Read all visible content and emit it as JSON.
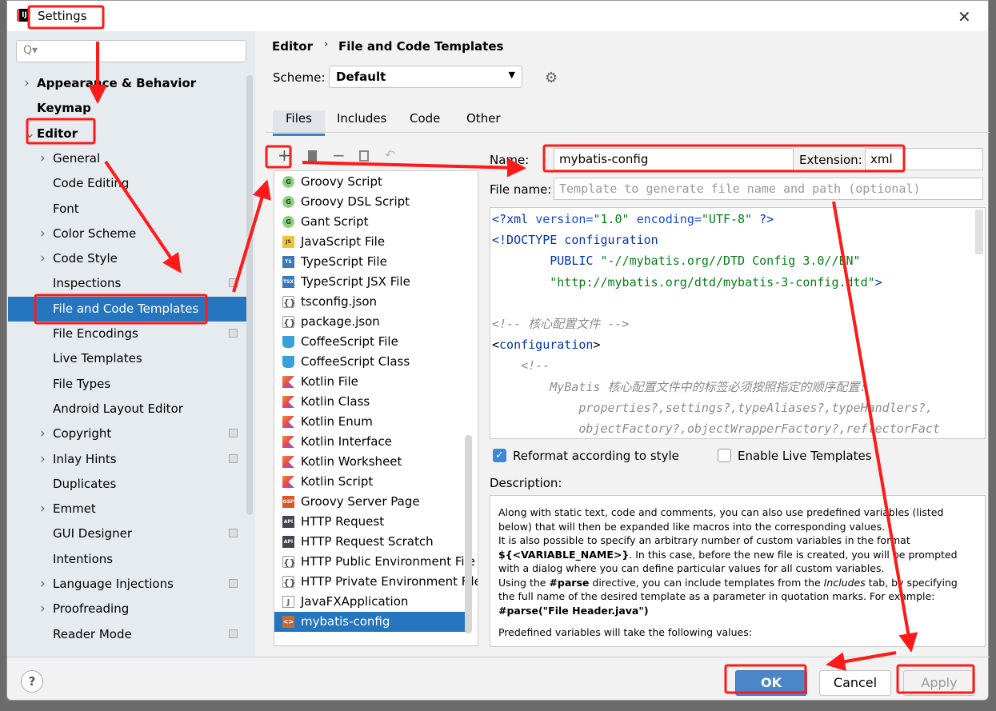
{
  "window": {
    "title": "Settings",
    "app_icon": "IJ"
  },
  "sidebar": {
    "search_placeholder": "Q▾",
    "items": [
      {
        "label": "Appearance & Behavior",
        "level": 0,
        "arrow": "collapsed"
      },
      {
        "label": "Keymap",
        "level": 0,
        "arrow": ""
      },
      {
        "label": "Editor",
        "level": 0,
        "arrow": "expanded"
      },
      {
        "label": "General",
        "level": 1,
        "arrow": "collapsed"
      },
      {
        "label": "Code Editing",
        "level": 1,
        "arrow": ""
      },
      {
        "label": "Font",
        "level": 1,
        "arrow": ""
      },
      {
        "label": "Color Scheme",
        "level": 1,
        "arrow": "collapsed"
      },
      {
        "label": "Code Style",
        "level": 1,
        "arrow": "collapsed"
      },
      {
        "label": "Inspections",
        "level": 1,
        "arrow": "",
        "copy": true
      },
      {
        "label": "File and Code Templates",
        "level": 1,
        "arrow": "",
        "copy": true,
        "selected": true
      },
      {
        "label": "File Encodings",
        "level": 1,
        "arrow": "",
        "copy": true
      },
      {
        "label": "Live Templates",
        "level": 1,
        "arrow": ""
      },
      {
        "label": "File Types",
        "level": 1,
        "arrow": ""
      },
      {
        "label": "Android Layout Editor",
        "level": 1,
        "arrow": ""
      },
      {
        "label": "Copyright",
        "level": 1,
        "arrow": "collapsed",
        "copy": true
      },
      {
        "label": "Inlay Hints",
        "level": 1,
        "arrow": "collapsed",
        "copy": true
      },
      {
        "label": "Duplicates",
        "level": 1,
        "arrow": ""
      },
      {
        "label": "Emmet",
        "level": 1,
        "arrow": "collapsed"
      },
      {
        "label": "GUI Designer",
        "level": 1,
        "arrow": "",
        "copy": true
      },
      {
        "label": "Intentions",
        "level": 1,
        "arrow": ""
      },
      {
        "label": "Language Injections",
        "level": 1,
        "arrow": "collapsed",
        "copy": true
      },
      {
        "label": "Proofreading",
        "level": 1,
        "arrow": "collapsed"
      },
      {
        "label": "Reader Mode",
        "level": 1,
        "arrow": "",
        "copy": true
      }
    ]
  },
  "breadcrumb": [
    "Editor",
    "File and Code Templates"
  ],
  "scheme": {
    "label": "Scheme:",
    "value": "Default"
  },
  "tabs": [
    {
      "label": "Files",
      "active": true
    },
    {
      "label": "Includes"
    },
    {
      "label": "Code"
    },
    {
      "label": "Other"
    }
  ],
  "toolbar": [
    "plus-icon",
    "copy-file-icon",
    "minus-icon",
    "duplicate-icon",
    "reset-icon"
  ],
  "files": [
    {
      "label": "Groovy Script",
      "icon": "g",
      "glyph": "G"
    },
    {
      "label": "Groovy DSL Script",
      "icon": "g",
      "glyph": "G"
    },
    {
      "label": "Gant Script",
      "icon": "g",
      "glyph": "G"
    },
    {
      "label": "JavaScript File",
      "icon": "js",
      "glyph": "JS"
    },
    {
      "label": "TypeScript File",
      "icon": "ts",
      "glyph": "TS"
    },
    {
      "label": "TypeScript JSX File",
      "icon": "ts",
      "glyph": "TSX"
    },
    {
      "label": "tsconfig.json",
      "icon": "json",
      "glyph": "{}"
    },
    {
      "label": "package.json",
      "icon": "json",
      "glyph": "{}"
    },
    {
      "label": "CoffeeScript File",
      "icon": "coffee",
      "glyph": ""
    },
    {
      "label": "CoffeeScript Class",
      "icon": "coffee",
      "glyph": ""
    },
    {
      "label": "Kotlin File",
      "icon": "kt",
      "glyph": ""
    },
    {
      "label": "Kotlin Class",
      "icon": "kt",
      "glyph": ""
    },
    {
      "label": "Kotlin Enum",
      "icon": "kt",
      "glyph": ""
    },
    {
      "label": "Kotlin Interface",
      "icon": "kt",
      "glyph": ""
    },
    {
      "label": "Kotlin Worksheet",
      "icon": "kt",
      "glyph": ""
    },
    {
      "label": "Kotlin Script",
      "icon": "kt",
      "glyph": ""
    },
    {
      "label": "Groovy Server Page",
      "icon": "gsp",
      "glyph": "GSP"
    },
    {
      "label": "HTTP Request",
      "icon": "api",
      "glyph": "API"
    },
    {
      "label": "HTTP Request Scratch",
      "icon": "api",
      "glyph": "API"
    },
    {
      "label": "HTTP Public Environment File",
      "icon": "json",
      "glyph": "{}"
    },
    {
      "label": "HTTP Private Environment File",
      "icon": "json",
      "glyph": "{}"
    },
    {
      "label": "JavaFXApplication",
      "icon": "java",
      "glyph": "J"
    },
    {
      "label": "mybatis-config",
      "icon": "xml",
      "glyph": "<>",
      "selected": true
    }
  ],
  "form": {
    "name_label": "Name:",
    "name_value": "mybatis-config",
    "extension_label": "Extension:",
    "extension_value": "xml",
    "filename_label": "File name:",
    "filename_placeholder": "Template to generate file name and path (optional)"
  },
  "code_lines": [
    [
      [
        "<?",
        "tag"
      ],
      [
        "xml ",
        "tag"
      ],
      [
        "version=",
        "attr"
      ],
      [
        "\"1.0\" ",
        "val"
      ],
      [
        "encoding=",
        "attr"
      ],
      [
        "\"UTF-8\" ",
        "val"
      ],
      [
        "?>",
        "tag"
      ]
    ],
    [
      [
        "<!DOCTYPE configuration",
        "tag"
      ]
    ],
    [
      [
        "        PUBLIC ",
        "tag"
      ],
      [
        "\"-//mybatis.org//DTD Config 3.0//EN\"",
        "val"
      ]
    ],
    [
      [
        "        \"http://mybatis.org/dtd/mybatis-3-config.dtd\"",
        "val"
      ],
      [
        ">",
        "tag"
      ]
    ],
    [
      [
        "",
        "pl"
      ]
    ],
    [
      [
        "<!-- 核心配置文件 -->",
        "com"
      ]
    ],
    [
      [
        "<",
        "pl"
      ],
      [
        "configuration",
        "tag"
      ],
      [
        ">",
        "pl"
      ]
    ],
    [
      [
        "    <!--",
        "com"
      ]
    ],
    [
      [
        "        MyBatis 核心配置文件中的标签必须按照指定的顺序配置:",
        "com"
      ]
    ],
    [
      [
        "            properties?,settings?,typeAliases?,typeHandlers?,",
        "com"
      ]
    ],
    [
      [
        "            objectFactory?,objectWrapperFactory?,reflectorFact",
        "com"
      ]
    ]
  ],
  "options": {
    "reformat": {
      "label": "Reformat according to style",
      "checked": true
    },
    "live": {
      "label": "Enable Live Templates",
      "checked": false
    }
  },
  "description": {
    "label": "Description:",
    "p1": "Along with static text, code and comments, you can also use predefined variables (listed below) that will then be expanded like macros into the corresponding values.",
    "p2a": "It is also possible to specify an arbitrary number of custom variables in the format ",
    "p2b": "${<VARIABLE_NAME>}",
    "p2c": ". In this case, before the new file is created, you will be prompted with a dialog where you can define particular values for all custom variables.",
    "p3a": "Using the ",
    "p3b": "#parse",
    "p3c": " directive, you can include templates from the ",
    "p3d": "Includes",
    "p3e": " tab, by specifying the full name of the desired template as a parameter in quotation marks. For example:",
    "p3f": "#parse(\"File Header.java\")",
    "p4": "Predefined variables will take the following values:"
  },
  "buttons": {
    "help": "?",
    "ok": "OK",
    "cancel": "Cancel",
    "apply": "Apply"
  },
  "colors": {
    "selection": "#2675bf",
    "annotation": "#ff1a1a",
    "sidebar_bg": "#e6ebf0"
  }
}
